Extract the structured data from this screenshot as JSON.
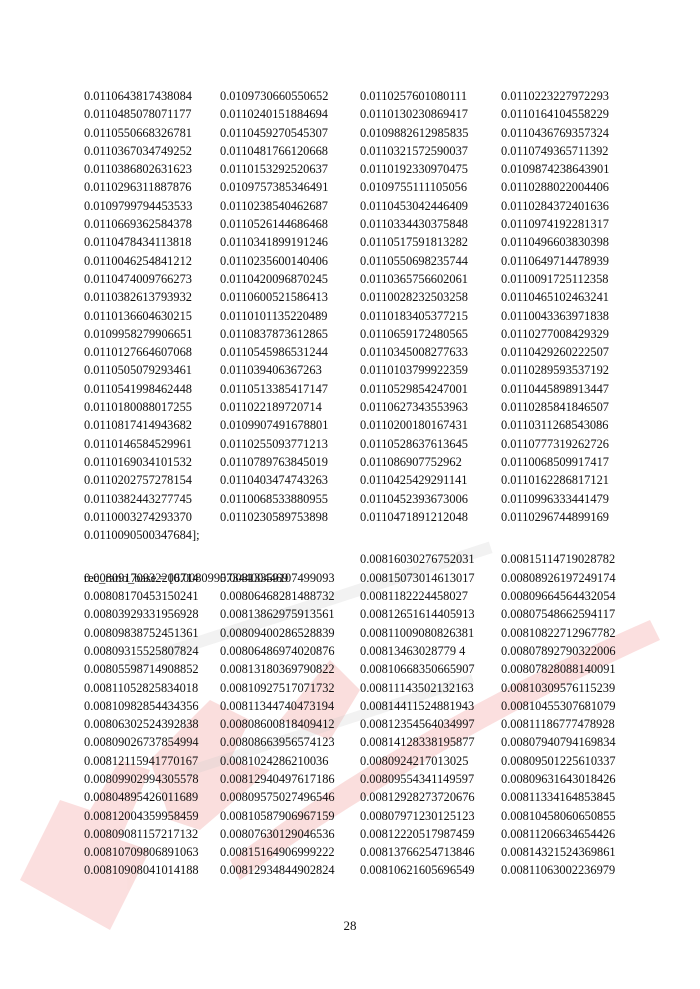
{
  "watermark": {
    "color": "#e53935"
  },
  "rec_ratio_tail": {
    "rows": [
      [
        "0.0110643817438084",
        "0.0109730660550652",
        "0.0110257601080111",
        "0.0110223227972293"
      ],
      [
        "0.0110485078071177",
        "0.0110240151884694",
        "0.0110130230869417",
        "0.0110164104558229"
      ],
      [
        "0.0110550668326781",
        "0.0110459270545307",
        "0.0109882612985835",
        "0.0110436769357324"
      ],
      [
        "0.0110367034749252",
        "0.0110481766120668",
        "0.0110321572590037",
        "0.0110749365711392"
      ],
      [
        "0.0110386802631623",
        "0.0110153292520637",
        "0.0110192330970475",
        "0.0109874238643901"
      ],
      [
        "0.0110296311887876",
        "0.0109757385346491",
        "0.0109755111105056",
        "0.0110288022004406"
      ],
      [
        "0.0109799794453533",
        "0.0110238540462687",
        "0.0110453042446409",
        "0.0110284372401636"
      ],
      [
        "0.0110669362584378",
        "0.0110526144686468",
        "0.0110334430375848",
        "0.0110974192281317"
      ],
      [
        "0.0110478434113818",
        "0.0110341899191246",
        "0.0110517591813282",
        "0.0110496603830398"
      ],
      [
        "0.0110046254841212",
        "0.0110235600140406",
        "0.0110550698235744",
        "0.0110649714478939"
      ],
      [
        "0.0110474009766273",
        "0.0110420096870245",
        "0.0110365756602061",
        "0.0110091725112358"
      ],
      [
        "0.0110382613793932",
        "0.0110600521586413",
        "0.0110028232503258",
        "0.0110465102463241"
      ],
      [
        "0.0110136604630215",
        "0.0110101135220489",
        "0.0110183405377215",
        "0.0110043363971838"
      ],
      [
        "0.0109958279906651",
        "0.0110837873612865",
        "0.0110659172480565",
        "0.0110277008429329"
      ],
      [
        "0.0110127664607068",
        "0.0110545986531244",
        "0.0110345008277633",
        "0.0110429260222507"
      ],
      [
        "0.0110505079293461",
        "0.011039406367263",
        "0.0110103799922359",
        "0.0110289593537192"
      ],
      [
        "0.0110541998462448",
        "0.0110513385417147",
        "0.0110529854247001",
        "0.0110445898913447"
      ],
      [
        "0.0110180088017255",
        "0.011022189720714",
        "0.0110627343553963",
        "0.0110285841846507"
      ],
      [
        "0.0110817414943682",
        "0.0109907491678801",
        "0.0110200180167431",
        "0.0110311268543086"
      ],
      [
        "0.0110146584529961",
        "0.0110255093771213",
        "0.0110528637613645",
        "0.0110777319262726"
      ],
      [
        "0.0110169034101532",
        "0.0110789763845019",
        "0.011086907752962",
        "0.0110068509917417"
      ],
      [
        "0.0110202757278154",
        "0.0110403474743263",
        "0.0110425429291141",
        "0.0110162286817121"
      ],
      [
        "0.0110382443277745",
        "0.0110068533880955",
        "0.0110452393673006",
        "0.0110996333441479"
      ],
      [
        "0.0110003274293370",
        "0.0110230589753898",
        "0.0110471891212048",
        "0.0110296744899169"
      ]
    ],
    "last_line": "0.0110090500347684];"
  },
  "rec_ratio_base": {
    "assignment": "rec_ratio_base = [0.00809957344004469",
    "first_row_rest": [
      "0.00816030276752031",
      "0.00815114719028782"
    ],
    "rows": [
      [
        "0.00809170932206714",
        "0.00813359107499093",
        "0.00815073014613017",
        "0.00808926197249174"
      ],
      [
        "0.00808170453150241",
        "0.00806468281488732",
        "0.0081182224458027",
        "0.00809664564432054"
      ],
      [
        "0.00803929331956928",
        "0.00813862975913561",
        "0.00812651614405913",
        "0.00807548662594117"
      ],
      [
        "0.00809838752451361",
        "0.00809400286528839",
        "0.00811009080826381",
        "0.00810822712967782"
      ],
      [
        "0.00809315525807824",
        "0.00806486974020876",
        "0.00813463028779 4",
        "0.00807892790322006"
      ],
      [
        "0.00805598714908852",
        "0.00813180369790822",
        "0.00810668350665907",
        "0.00807828088140091"
      ],
      [
        "0.00811052825834018",
        "0.00810927517071732",
        "0.00811143502132163",
        "0.00810309576115239"
      ],
      [
        "0.00810982854434356",
        "0.00811344740473194",
        "0.00814411524881943",
        "0.00810455307681079"
      ],
      [
        "0.00806302524392838",
        "0.00808600818409412",
        "0.00812354564034997",
        "0.00811186777478928"
      ],
      [
        "0.00809026737854994",
        "0.00808663956574123",
        "0.00814128338195877",
        "0.00807940794169834"
      ],
      [
        "0.00812115941770167",
        "0.0081024286210036",
        "0.0080924217013025",
        "0.00809501225610337"
      ],
      [
        "0.00809902994305578",
        "0.00812940497617186",
        "0.00809554341149597",
        "0.00809631643018426"
      ],
      [
        "0.00804895426011689",
        "0.00809575027496546",
        "0.00812928273720676",
        "0.00811334164853845"
      ],
      [
        "0.00812004359958459",
        "0.00810587906967159",
        "0.00807971230125123",
        "0.00810458060650855"
      ],
      [
        "0.00809081157217132",
        "0.00807630129046536",
        "0.00812220517987459",
        "0.00811206634654426"
      ],
      [
        "0.00810709806891063",
        "0.00815164906999222",
        "0.00813766254713846",
        "0.00814321524369861"
      ],
      [
        "0.00810908041014188",
        "0.00812934844902824",
        "0.00810621605696549",
        "0.00811063002236979"
      ]
    ]
  },
  "page_number": "28"
}
